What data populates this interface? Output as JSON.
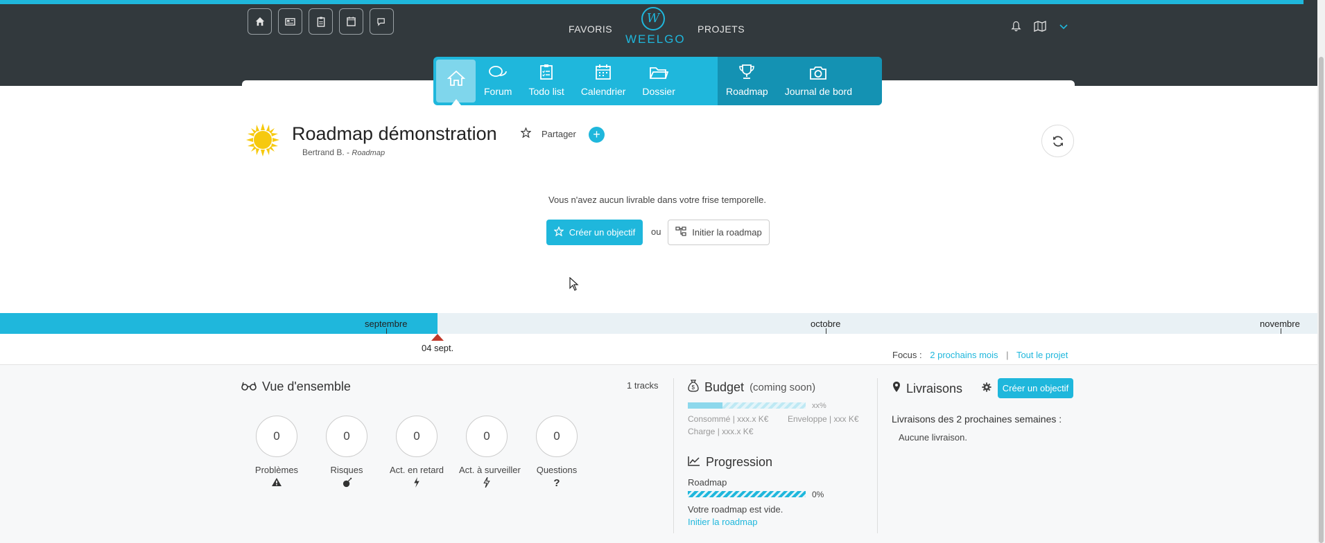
{
  "header": {
    "links": {
      "favoris": "FAVORIS",
      "projets": "PROJETS"
    },
    "logo_text": "WEELGO",
    "quick_icons": [
      "home-icon",
      "news-icon",
      "clipboard-icon",
      "calendar-icon",
      "chat-icon"
    ],
    "right_icons": [
      "bell-icon",
      "map-icon",
      "chevron-down-icon"
    ]
  },
  "modules": {
    "forum": "Forum",
    "todo": "Todo list",
    "calendar": "Calendrier",
    "dossier": "Dossier",
    "roadmap": "Roadmap",
    "journal": "Journal de bord"
  },
  "page": {
    "title": "Roadmap démonstration",
    "share": "Partager",
    "author": "Bertrand B.",
    "author_sep": " - ",
    "type": "Roadmap"
  },
  "empty_state": {
    "message": "Vous n'avez aucun livrable dans votre frise temporelle.",
    "create_goal": "Créer un objectif",
    "or": "ou",
    "init_roadmap": "Initier la roadmap"
  },
  "timeline": {
    "months": {
      "sep": "septembre",
      "oct": "octobre",
      "nov": "novembre"
    },
    "today": "04 sept.",
    "focus_label": "Focus :",
    "focus_next": "2 prochains mois",
    "focus_sep": "|",
    "focus_all": "Tout le projet"
  },
  "overview": {
    "title": "Vue d'ensemble",
    "tracks": "1 tracks",
    "stats": [
      {
        "value": "0",
        "label": "Problèmes",
        "icon": "warning-icon"
      },
      {
        "value": "0",
        "label": "Risques",
        "icon": "bomb-icon"
      },
      {
        "value": "0",
        "label": "Act. en retard",
        "icon": "bolt-icon"
      },
      {
        "value": "0",
        "label": "Act. à surveiller",
        "icon": "bolt-outline-icon"
      },
      {
        "value": "0",
        "label": "Questions",
        "icon": "question-icon"
      }
    ]
  },
  "budget": {
    "title": "Budget",
    "note": "(coming soon)",
    "pct": "xx%",
    "consumed": "Consommé | xxx.x K€",
    "envelope": "Enveloppe | xxx K€",
    "charge": "Charge | xxx.x K€"
  },
  "progression": {
    "title": "Progression",
    "label": "Roadmap",
    "pct": "0%",
    "progress": 0,
    "empty": "Votre roadmap est vide.",
    "link": "Initier la roadmap"
  },
  "deliveries": {
    "title": "Livraisons",
    "button": "Créer un objectif",
    "subtitle": "Livraisons des 2 prochaines semaines :",
    "none": "Aucune livraison."
  },
  "colors": {
    "accent": "#1fb7dc",
    "header_bg": "#32393d",
    "today_marker": "#c0392b"
  }
}
